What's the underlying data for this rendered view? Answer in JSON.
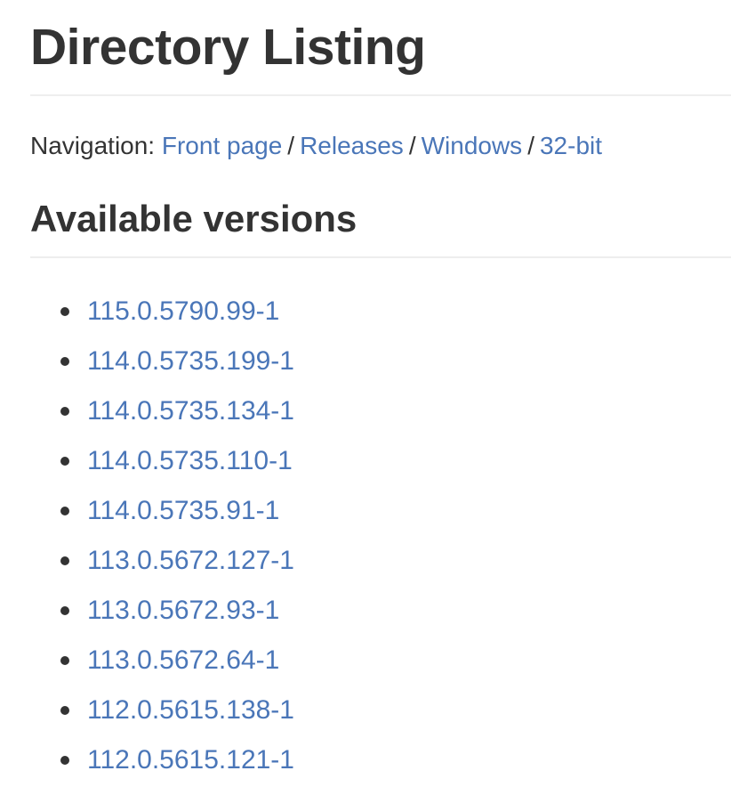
{
  "page": {
    "title": "Directory Listing"
  },
  "navigation": {
    "label": "Navigation:",
    "separator": "/",
    "links": [
      {
        "label": "Front page"
      },
      {
        "label": "Releases"
      },
      {
        "label": "Windows"
      },
      {
        "label": "32-bit"
      }
    ]
  },
  "versions": {
    "heading": "Available versions",
    "items": [
      {
        "label": "115.0.5790.99-1"
      },
      {
        "label": "114.0.5735.199-1"
      },
      {
        "label": "114.0.5735.134-1"
      },
      {
        "label": "114.0.5735.110-1"
      },
      {
        "label": "114.0.5735.91-1"
      },
      {
        "label": "113.0.5672.127-1"
      },
      {
        "label": "113.0.5672.93-1"
      },
      {
        "label": "113.0.5672.64-1"
      },
      {
        "label": "112.0.5615.138-1"
      },
      {
        "label": "112.0.5615.121-1"
      }
    ]
  },
  "colors": {
    "link": "#4a76b8",
    "text": "#333333",
    "rule": "#eeeeee"
  }
}
